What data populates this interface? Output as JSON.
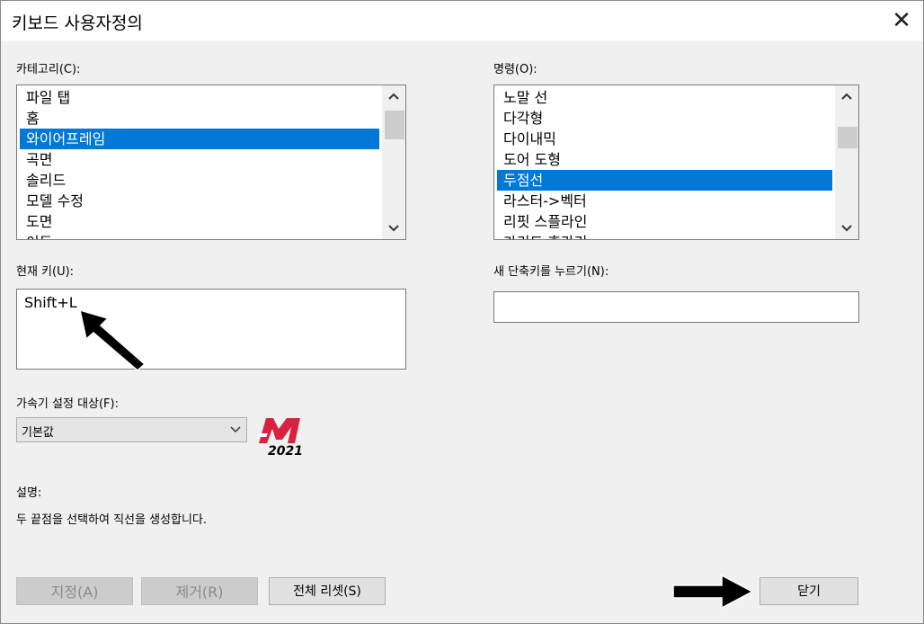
{
  "window": {
    "title": "키보드 사용자정의",
    "close_glyph": "✕"
  },
  "category": {
    "label": "카테고리(C):",
    "items": [
      "파일 탭",
      "홈",
      "와이어프레임",
      "곡면",
      "솔리드",
      "모델 수정",
      "도면",
      "이동"
    ],
    "selected_index": 2
  },
  "command": {
    "label": "명령(O):",
    "items": [
      "노말 선",
      "다각형",
      "다이내믹",
      "도어 도형",
      "두점선",
      "라스터->벡터",
      "리핏 스플라인",
      "가리드 후라리"
    ],
    "selected_index": 4
  },
  "current_key": {
    "label": "현재 키(U):",
    "value": "Shift+L"
  },
  "new_shortcut": {
    "label": "새 단축키를 누르기(N):",
    "value": ""
  },
  "accelerator": {
    "label": "가속기 설정 대상(F):",
    "selected": "기본값"
  },
  "logo": {
    "text": "2021",
    "color": "#d9223f"
  },
  "description": {
    "label": "설명:",
    "text": "두 끝점을 선택하여 직선을 생성합니다."
  },
  "buttons": {
    "assign": "지정(A)",
    "remove": "제거(R)",
    "reset_all": "전체 리셋(S)",
    "close": "닫기"
  },
  "icons": {
    "scroll_up": "▲",
    "scroll_down": "▼",
    "combo_arrow": "chevron-down"
  }
}
